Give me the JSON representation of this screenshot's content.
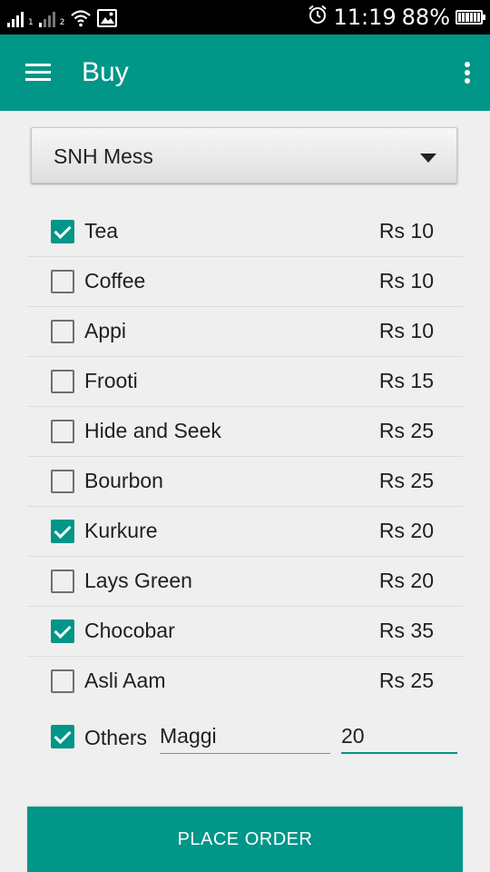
{
  "status_bar": {
    "sim1_label": "1",
    "sim2_label": "2",
    "time": "11:19",
    "battery_percent": "88%",
    "battery_level": 0.88,
    "icons": [
      "signal-icon",
      "signal-icon",
      "wifi-icon",
      "image-icon",
      "alarm-icon",
      "battery-icon"
    ]
  },
  "app_bar": {
    "title": "Buy",
    "menu_icon": "hamburger-menu-icon",
    "overflow_icon": "more-vert-icon",
    "color": "#009688"
  },
  "mess_selector": {
    "selected": "SNH Mess"
  },
  "items": [
    {
      "name": "Tea",
      "price": "Rs 10",
      "checked": true
    },
    {
      "name": "Coffee",
      "price": "Rs 10",
      "checked": false
    },
    {
      "name": "Appi",
      "price": "Rs 10",
      "checked": false
    },
    {
      "name": "Frooti",
      "price": "Rs 15",
      "checked": false
    },
    {
      "name": "Hide and Seek",
      "price": "Rs 25",
      "checked": false
    },
    {
      "name": "Bourbon",
      "price": "Rs 25",
      "checked": false
    },
    {
      "name": "Kurkure",
      "price": "Rs 20",
      "checked": true
    },
    {
      "name": "Lays Green",
      "price": "Rs 20",
      "checked": false
    },
    {
      "name": "Chocobar",
      "price": "Rs 35",
      "checked": true
    },
    {
      "name": "Asli Aam",
      "price": "Rs 25",
      "checked": false
    }
  ],
  "others": {
    "label": "Others",
    "checked": true,
    "item_value": "Maggi",
    "price_value": "20"
  },
  "place_order_label": "PLACE ORDER",
  "colors": {
    "accent": "#009688",
    "background": "#efefef"
  }
}
